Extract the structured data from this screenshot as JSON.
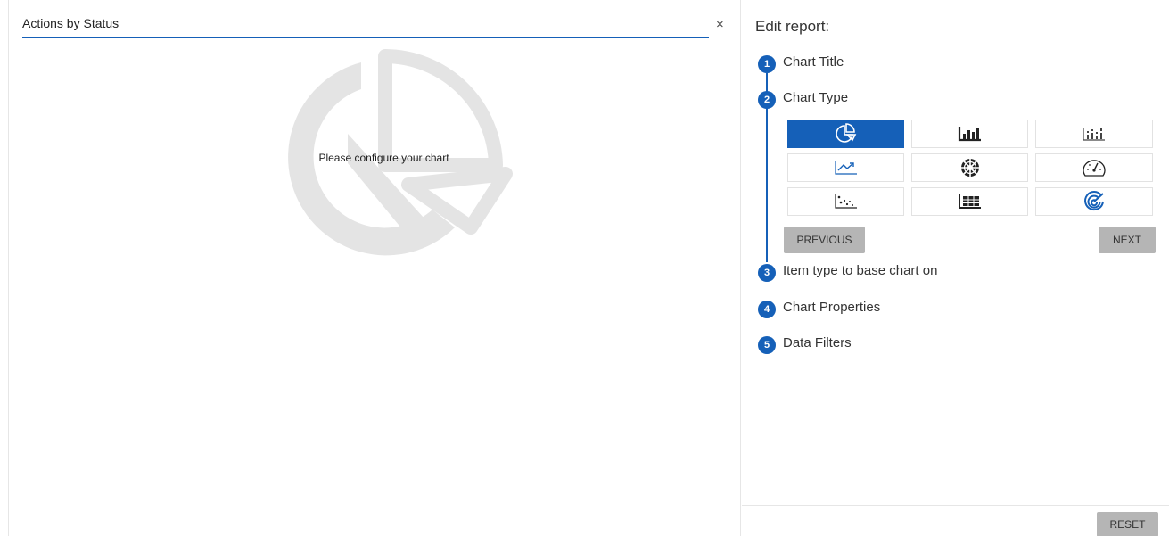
{
  "chart_panel": {
    "title_value": "Actions by Status",
    "close_symbol": "×",
    "placeholder": "Please configure your chart",
    "placeholder_icon": "pie-chart-icon"
  },
  "editor": {
    "heading": "Edit report:",
    "steps": [
      {
        "number": "1",
        "label": "Chart Title"
      },
      {
        "number": "2",
        "label": "Chart Type"
      },
      {
        "number": "3",
        "label": "Item type to base chart on"
      },
      {
        "number": "4",
        "label": "Chart Properties"
      },
      {
        "number": "5",
        "label": "Data Filters"
      }
    ],
    "chart_types": [
      {
        "icon": "pie-chart-icon",
        "selected": true
      },
      {
        "icon": "bar-chart-icon",
        "selected": false
      },
      {
        "icon": "stacked-bar-chart-icon",
        "selected": false
      },
      {
        "icon": "line-chart-icon",
        "selected": false
      },
      {
        "icon": "sunburst-chart-icon",
        "selected": false
      },
      {
        "icon": "gauge-chart-icon",
        "selected": false
      },
      {
        "icon": "scatter-chart-icon",
        "selected": false
      },
      {
        "icon": "table-grid-icon",
        "selected": false
      },
      {
        "icon": "radar-chart-icon",
        "selected": false
      }
    ],
    "previous_label": "PREVIOUS",
    "next_label": "NEXT",
    "reset_label": "RESET"
  },
  "colors": {
    "accent": "#1560b8",
    "button_gray": "#b5b5b5",
    "placeholder_gray": "#e4e4e4"
  }
}
